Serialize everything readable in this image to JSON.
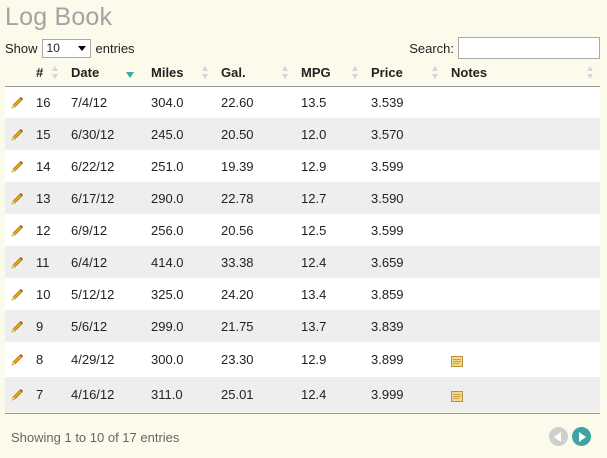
{
  "page": {
    "title": "Log Book"
  },
  "length_control": {
    "show_label": "Show",
    "selected": "10",
    "entries_label": "entries"
  },
  "search": {
    "label": "Search:",
    "value": ""
  },
  "table": {
    "headers": [
      "#",
      "Date",
      "Miles",
      "Gal.",
      "MPG",
      "Price",
      "Notes"
    ],
    "sorted_column": "Date",
    "rows": [
      {
        "num": "16",
        "date": "7/4/12",
        "miles": "304.0",
        "gal": "22.60",
        "mpg": "13.5",
        "price": "3.539",
        "has_note": false
      },
      {
        "num": "15",
        "date": "6/30/12",
        "miles": "245.0",
        "gal": "20.50",
        "mpg": "12.0",
        "price": "3.570",
        "has_note": false
      },
      {
        "num": "14",
        "date": "6/22/12",
        "miles": "251.0",
        "gal": "19.39",
        "mpg": "12.9",
        "price": "3.599",
        "has_note": false
      },
      {
        "num": "13",
        "date": "6/17/12",
        "miles": "290.0",
        "gal": "22.78",
        "mpg": "12.7",
        "price": "3.590",
        "has_note": false
      },
      {
        "num": "12",
        "date": "6/9/12",
        "miles": "256.0",
        "gal": "20.56",
        "mpg": "12.5",
        "price": "3.599",
        "has_note": false
      },
      {
        "num": "11",
        "date": "6/4/12",
        "miles": "414.0",
        "gal": "33.38",
        "mpg": "12.4",
        "price": "3.659",
        "has_note": false
      },
      {
        "num": "10",
        "date": "5/12/12",
        "miles": "325.0",
        "gal": "24.20",
        "mpg": "13.4",
        "price": "3.859",
        "has_note": false
      },
      {
        "num": "9",
        "date": "5/6/12",
        "miles": "299.0",
        "gal": "21.75",
        "mpg": "13.7",
        "price": "3.839",
        "has_note": false
      },
      {
        "num": "8",
        "date": "4/29/12",
        "miles": "300.0",
        "gal": "23.30",
        "mpg": "12.9",
        "price": "3.899",
        "has_note": true
      },
      {
        "num": "7",
        "date": "4/16/12",
        "miles": "311.0",
        "gal": "25.01",
        "mpg": "12.4",
        "price": "3.999",
        "has_note": true
      }
    ]
  },
  "footer": {
    "info": "Showing 1 to 10 of 17 entries"
  },
  "colors": {
    "background": "#fcfaea",
    "title": "#a3a3a3",
    "accent": "#3fa3a3",
    "row_alt": "#eeeeee",
    "pencil": "#e8a317"
  },
  "icons": {
    "edit": "pencil-icon",
    "note": "note-icon",
    "prev": "previous-page-icon",
    "next": "next-page-icon"
  }
}
